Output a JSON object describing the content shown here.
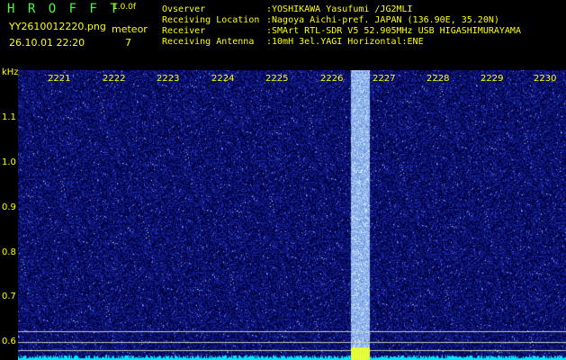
{
  "header": {
    "app_title": "H R O F F T",
    "version": "1.0.0f",
    "filename": "YY2610012220.png",
    "timestamp": "26.10.01 22:20",
    "mode_label": "meteor",
    "count": "7",
    "observer_label": "Ovserver",
    "observer_value": ":YOSHIKAWA Yasufumi /JG2MLI",
    "location_label": "Receiving Location",
    "location_value": ":Nagoya Aichi-pref. JAPAN (136.90E, 35.20N)",
    "receiver_label": "Receiver",
    "receiver_value": ":SMArt RTL-SDR V5 52.905MHz USB HIGASHIMURAYAMA",
    "antenna_label": "Receiving Antenna",
    "antenna_value": ":10mH 3el.YAGI Horizontal:ENE"
  },
  "axis": {
    "y_unit": "kHz",
    "y_ticks": [
      "1.1",
      "1.0",
      "0.9",
      "0.8",
      "0.7",
      "0.6"
    ],
    "x_ticks": [
      "2221",
      "2222",
      "2223",
      "2224",
      "2225",
      "2226",
      "2227",
      "2228",
      "2229",
      "2230"
    ]
  },
  "colors": {
    "background": "#000000",
    "noise_low": "#000050",
    "noise_high": "#3b5bff",
    "meteor_band": "#8ab0ff",
    "text_yellow": "#ffff00",
    "title_green": "#3fff3f",
    "baseline": "#00ffff"
  }
}
